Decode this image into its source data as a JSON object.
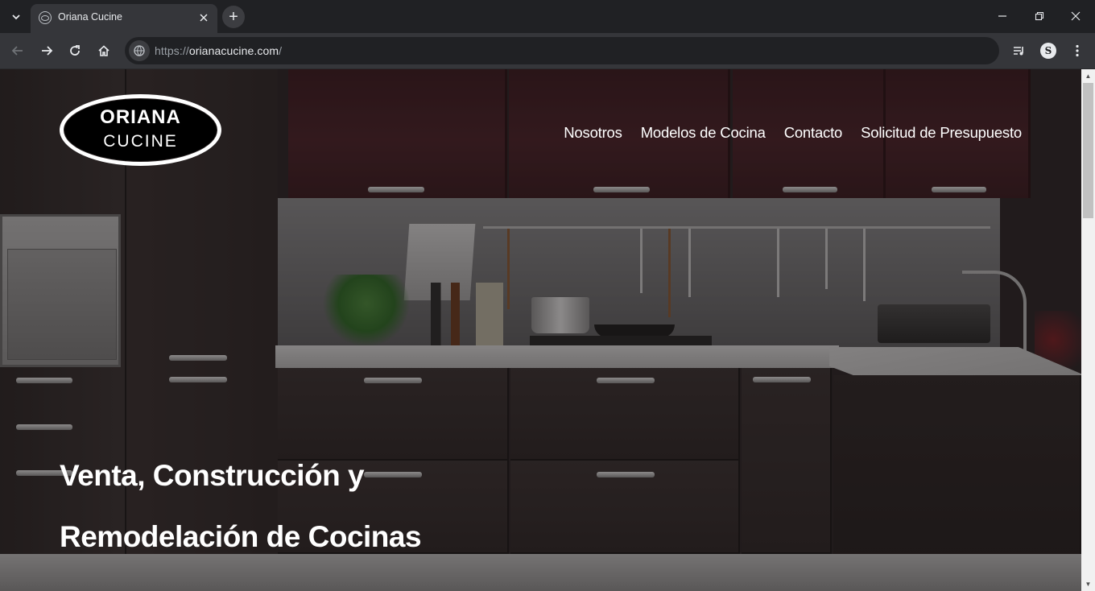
{
  "browser": {
    "tab": {
      "title": "Oriana Cucine"
    },
    "new_tab_label": "+",
    "address": {
      "scheme": "https://",
      "host": "orianacucine.com",
      "path": "/"
    },
    "profile_initial": "S"
  },
  "site": {
    "logo": {
      "line1": "ORIANA",
      "line2": "CUCINE"
    },
    "nav": [
      "Nosotros",
      "Modelos de Cocina",
      "Contacto",
      "Solicitud de Presupuesto"
    ],
    "hero": {
      "line1": "Venta, Construcción y",
      "line2": "Remodelación de Cocinas"
    }
  },
  "colors": {
    "chrome_dark": "#202124",
    "chrome_toolbar": "#35363a",
    "cabinet": "#4a2229",
    "text": "#ffffff"
  }
}
